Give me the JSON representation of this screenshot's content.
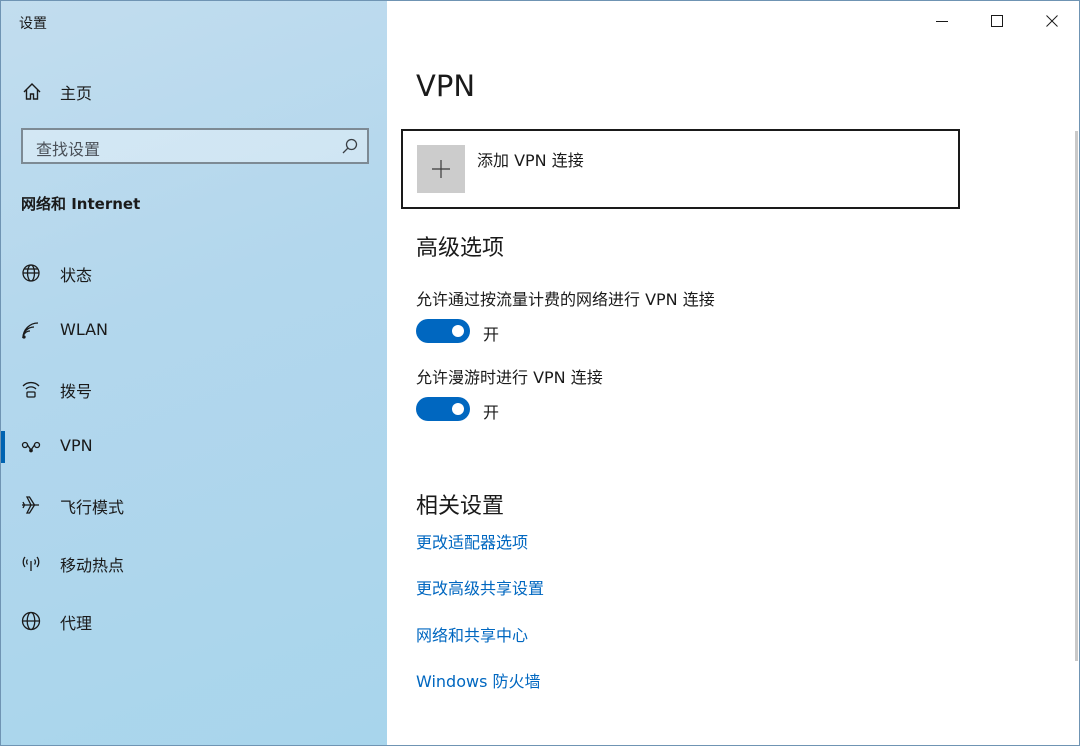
{
  "window": {
    "title": "设置"
  },
  "sidebar": {
    "home_label": "主页",
    "search_placeholder": "查找设置",
    "section_title": "网络和 Internet",
    "items": [
      {
        "label": "状态",
        "icon": "globe-status-icon"
      },
      {
        "label": "WLAN",
        "icon": "wifi-icon"
      },
      {
        "label": "拨号",
        "icon": "dialup-icon"
      },
      {
        "label": "VPN",
        "icon": "vpn-icon",
        "selected": true
      },
      {
        "label": "飞行模式",
        "icon": "airplane-icon"
      },
      {
        "label": "移动热点",
        "icon": "hotspot-icon"
      },
      {
        "label": "代理",
        "icon": "globe-icon"
      }
    ]
  },
  "main": {
    "title": "VPN",
    "add_vpn_label": "添加 VPN 连接",
    "advanced": {
      "heading": "高级选项",
      "options": [
        {
          "label": "允许通过按流量计费的网络进行 VPN 连接",
          "state": "开",
          "on": true
        },
        {
          "label": "允许漫游时进行 VPN 连接",
          "state": "开",
          "on": true
        }
      ]
    },
    "related": {
      "heading": "相关设置",
      "links": [
        "更改适配器选项",
        "更改高级共享设置",
        "网络和共享中心",
        "Windows 防火墙"
      ]
    }
  },
  "colors": {
    "accent": "#0067c0",
    "sidebar_bg": "#b3d7ed",
    "selection_indicator": "#0063b1"
  }
}
